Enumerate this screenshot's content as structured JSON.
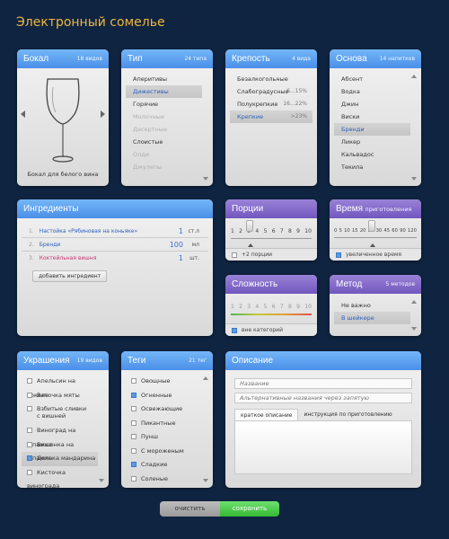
{
  "app": {
    "title": "Электронный сомелье"
  },
  "glass": {
    "title": "Бокал",
    "count": "18 видов",
    "caption": "Бокал для белого вина"
  },
  "type": {
    "title": "Тип",
    "count": "24 типа",
    "items": [
      {
        "label": "Аперитивы",
        "state": "normal"
      },
      {
        "label": "Дижестивы",
        "state": "selected"
      },
      {
        "label": "Горячие",
        "state": "normal"
      },
      {
        "label": "Молочные",
        "state": "dim"
      },
      {
        "label": "Десертные",
        "state": "dim"
      },
      {
        "label": "Слоистые",
        "state": "normal"
      },
      {
        "label": "Олди",
        "state": "dim"
      },
      {
        "label": "Джулепы",
        "state": "dim"
      }
    ]
  },
  "strength": {
    "title": "Крепость",
    "count": "4 вида",
    "items": [
      {
        "label": "Безалкогольные",
        "value": "",
        "state": "normal"
      },
      {
        "label": "Слабоградусные",
        "value": "6...15%",
        "state": "normal"
      },
      {
        "label": "Полукрепкие",
        "value": "16...22%",
        "state": "normal"
      },
      {
        "label": "Крепкие",
        "value": ">23%",
        "state": "selected"
      }
    ]
  },
  "base": {
    "title": "Основа",
    "count": "14 напитков",
    "items": [
      {
        "label": "Абсент",
        "state": "normal"
      },
      {
        "label": "Водка",
        "state": "normal"
      },
      {
        "label": "Джин",
        "state": "normal"
      },
      {
        "label": "Виски",
        "state": "normal"
      },
      {
        "label": "Бренди",
        "state": "selected"
      },
      {
        "label": "Ликер",
        "state": "normal"
      },
      {
        "label": "Кальвадос",
        "state": "normal"
      },
      {
        "label": "Текила",
        "state": "normal"
      }
    ]
  },
  "ingredients": {
    "title": "Ингредиенты",
    "rows": [
      {
        "num": "1.",
        "name": "Настойка «Рябиновая на коньяке»",
        "qty": "1",
        "unit": "ст.л",
        "color": "#2b5fc0"
      },
      {
        "num": "2.",
        "name": "Бренди",
        "qty": "100",
        "unit": "мл",
        "color": "#2b5fc0"
      },
      {
        "num": "3.",
        "name": "Коктейльная вишня",
        "qty": "1",
        "unit": "шт.",
        "color": "#c8356e"
      }
    ],
    "add_label": "добавить ингредиент"
  },
  "portions": {
    "title": "Порции",
    "ticks": [
      "1",
      "2",
      "3",
      "4",
      "5",
      "6",
      "7",
      "8",
      "9",
      "10"
    ],
    "value": 3,
    "footer": "+2 порции"
  },
  "time": {
    "title": "Время",
    "subtitle": "приготовления",
    "ticks": [
      "0",
      "5",
      "10",
      "15",
      "20",
      "25",
      "30",
      "45",
      "60",
      "90",
      "120"
    ],
    "value": "15",
    "footer": "увеличенное время"
  },
  "complexity": {
    "title": "Сложность",
    "ticks": [
      "1",
      "2",
      "3",
      "4",
      "5",
      "6",
      "7",
      "8",
      "9",
      "10"
    ],
    "footer": "вне категорий"
  },
  "method": {
    "title": "Метод",
    "count": "5 методов",
    "items": [
      {
        "label": "Не важно",
        "state": "normal"
      },
      {
        "label": "В шейкере",
        "state": "selected"
      }
    ]
  },
  "decorations": {
    "title": "Украшения",
    "count": "19 видов",
    "items": [
      {
        "label": "Апельсин на бокале",
        "checked": false
      },
      {
        "label": "Веточка мяты",
        "checked": false
      },
      {
        "label": "Взбитые сливки с вишней",
        "checked": false
      },
      {
        "label": "Виноград на шпажке",
        "checked": false
      },
      {
        "label": "Вишенка на шпажке",
        "checked": false
      },
      {
        "label": "Долька мандарина",
        "checked": true
      },
      {
        "label": "Кисточка винограда",
        "checked": false
      }
    ]
  },
  "tags": {
    "title": "Теги",
    "count": "21 тег",
    "items": [
      {
        "label": "Овощные",
        "checked": false
      },
      {
        "label": "Огненные",
        "checked": true
      },
      {
        "label": "Освежающие",
        "checked": false
      },
      {
        "label": "Пикантные",
        "checked": false
      },
      {
        "label": "Пунш",
        "checked": false
      },
      {
        "label": "С мороженым",
        "checked": false
      },
      {
        "label": "Сладкие",
        "checked": true
      },
      {
        "label": "Соленые",
        "checked": false
      }
    ]
  },
  "description": {
    "title": "Описание",
    "name_placeholder": "Название",
    "alt_placeholder": "Альтернативные названия через запятую",
    "tabs": [
      "краткое описание",
      "инструкция по приготовлению"
    ]
  },
  "actions": {
    "clear": "очистить",
    "save": "сохранить"
  }
}
